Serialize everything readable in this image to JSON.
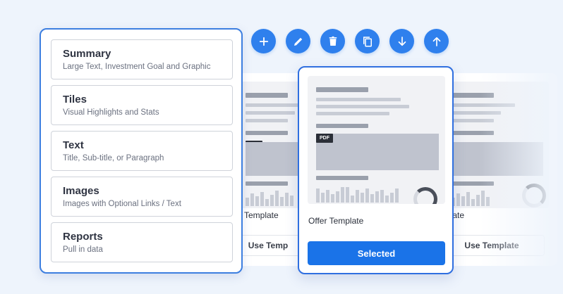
{
  "toolbar": {
    "buttons": [
      {
        "name": "add",
        "icon": "plus-icon"
      },
      {
        "name": "edit",
        "icon": "pencil-icon"
      },
      {
        "name": "delete",
        "icon": "trash-icon"
      },
      {
        "name": "duplicate",
        "icon": "copy-icon"
      },
      {
        "name": "move-down",
        "icon": "arrow-down-icon"
      },
      {
        "name": "move-up",
        "icon": "arrow-up-icon"
      }
    ],
    "accent": "#2f80ed"
  },
  "blocks": [
    {
      "title": "Summary",
      "desc": "Large Text, Investment Goal and Graphic"
    },
    {
      "title": "Tiles",
      "desc": "Visual Highlights and Stats"
    },
    {
      "title": "Text",
      "desc": "Title, Sub-title, or Paragraph"
    },
    {
      "title": "Images",
      "desc": "Images with Optional Links / Text"
    },
    {
      "title": "Reports",
      "desc": "Pull in data"
    }
  ],
  "templates": {
    "left": {
      "label": "Template",
      "button": "Use Temp"
    },
    "selected": {
      "label": "Offer Template",
      "button": "Selected",
      "tag": "PDF"
    },
    "right": {
      "label": "plate",
      "button": "Use Template"
    }
  },
  "colors": {
    "selected_button": "#1a73e8",
    "panel_border": "#3d7fe0"
  }
}
